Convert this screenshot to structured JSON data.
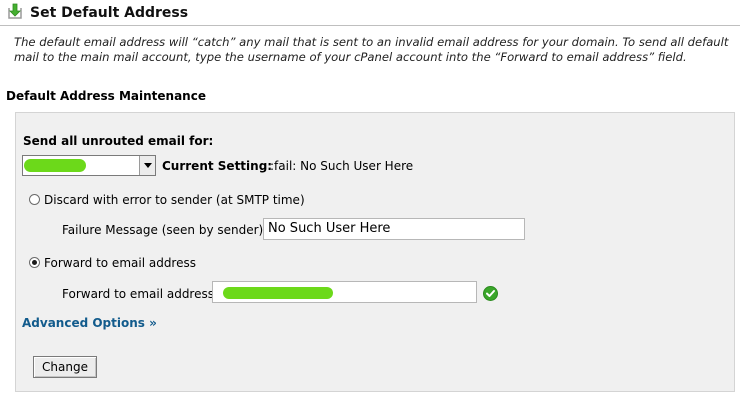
{
  "header": {
    "title": "Set Default Address",
    "description": "The default email address will “catch” any mail that is sent to an invalid email address for your domain. To send all default mail to the main mail account, type the username of your cPanel account into the “Forward to email address” field."
  },
  "section": {
    "title": "Default Address Maintenance"
  },
  "form": {
    "send_label": "Send all unrouted email for:",
    "domain_select_value": "",
    "current_setting_label": "Current Setting:",
    "current_setting_value": ":fail: No Such User Here",
    "discard_label": "Discard with error to sender (at SMTP time)",
    "discard_selected": false,
    "failure_label": "Failure Message (seen by sender):",
    "failure_value": "No Such User Here",
    "forward_label": "Forward to email address",
    "forward_selected": true,
    "forward_addr_label": "Forward to email address:",
    "forward_addr_value": "",
    "advanced_label": "Advanced Options »",
    "change_label": "Change"
  },
  "icons": {
    "header": "download-arrow-icon",
    "valid": "checkmark-icon"
  },
  "colors": {
    "link": "#125b8c",
    "panel_bg": "#f0f0f0",
    "valid_green": "#3aa62a",
    "redaction": "#6cd91a"
  }
}
